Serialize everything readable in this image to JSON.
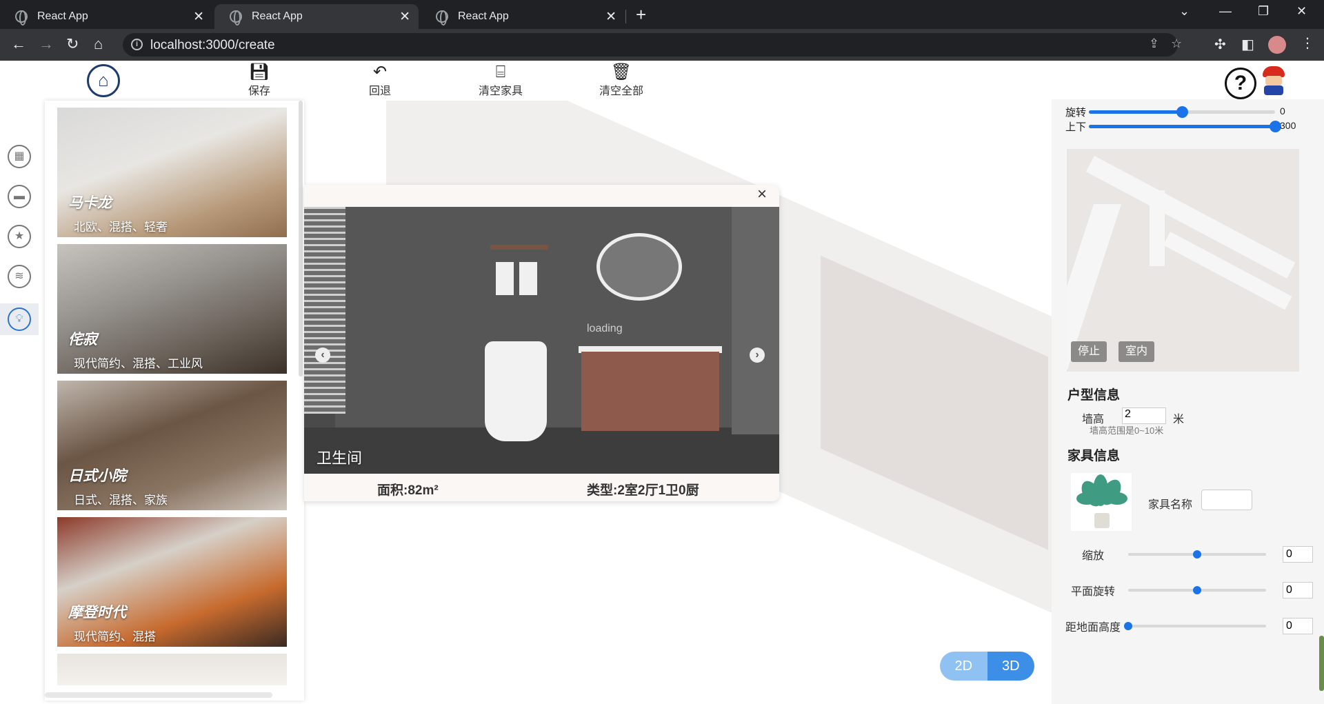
{
  "browser": {
    "tabs": [
      {
        "title": "React App",
        "active": false
      },
      {
        "title": "React App",
        "active": true
      },
      {
        "title": "React App",
        "active": false
      }
    ],
    "url": "localhost:3000/create"
  },
  "toolbar": {
    "save": "保存",
    "undo": "回退",
    "clear_furniture": "清空家具",
    "clear_all": "清空全部"
  },
  "styles": [
    {
      "name": "马卡龙",
      "tags": "北欧、混搭、轻奢"
    },
    {
      "name": "侘寂",
      "tags": "现代简约、混搭、工业风"
    },
    {
      "name": "日式小院",
      "tags": "日式、混搭、家族"
    },
    {
      "name": "摩登时代",
      "tags": "现代简约、混搭"
    }
  ],
  "preview": {
    "room": "卫生间",
    "area": "面积:82m²",
    "type": "类型:2室2厅1卫0厨",
    "loading": "loading"
  },
  "view_toggle": {
    "two_d": "2D",
    "three_d": "3D",
    "active": "3D"
  },
  "right": {
    "rotate_label": "旋转",
    "rotate_value": "0",
    "rotate_fraction": 0.5,
    "updown_label": "上下",
    "updown_value": "300",
    "updown_fraction": 1.0,
    "stop_btn": "停止",
    "indoor_btn": "室内",
    "house_title": "户型信息",
    "wall_label": "墙高",
    "wall_value": "2",
    "wall_unit": "米",
    "wall_hint": "墙高范围是0~10米",
    "furniture_title": "家具信息",
    "furniture_name_label": "家具名称",
    "furniture_name_value": "",
    "scale_label": "缩放",
    "scale_value": "0",
    "scale_fraction": 0.5,
    "plane_rotate_label": "平面旋转",
    "plane_rotate_value": "0",
    "plane_rotate_fraction": 0.5,
    "height_label": "距地面高度",
    "height_value": "0",
    "height_fraction": 0.0
  },
  "colors": {
    "accent": "#1a73e8",
    "toggle_active": "#3d8ee6",
    "toggle_inactive": "#8fc2f2"
  }
}
